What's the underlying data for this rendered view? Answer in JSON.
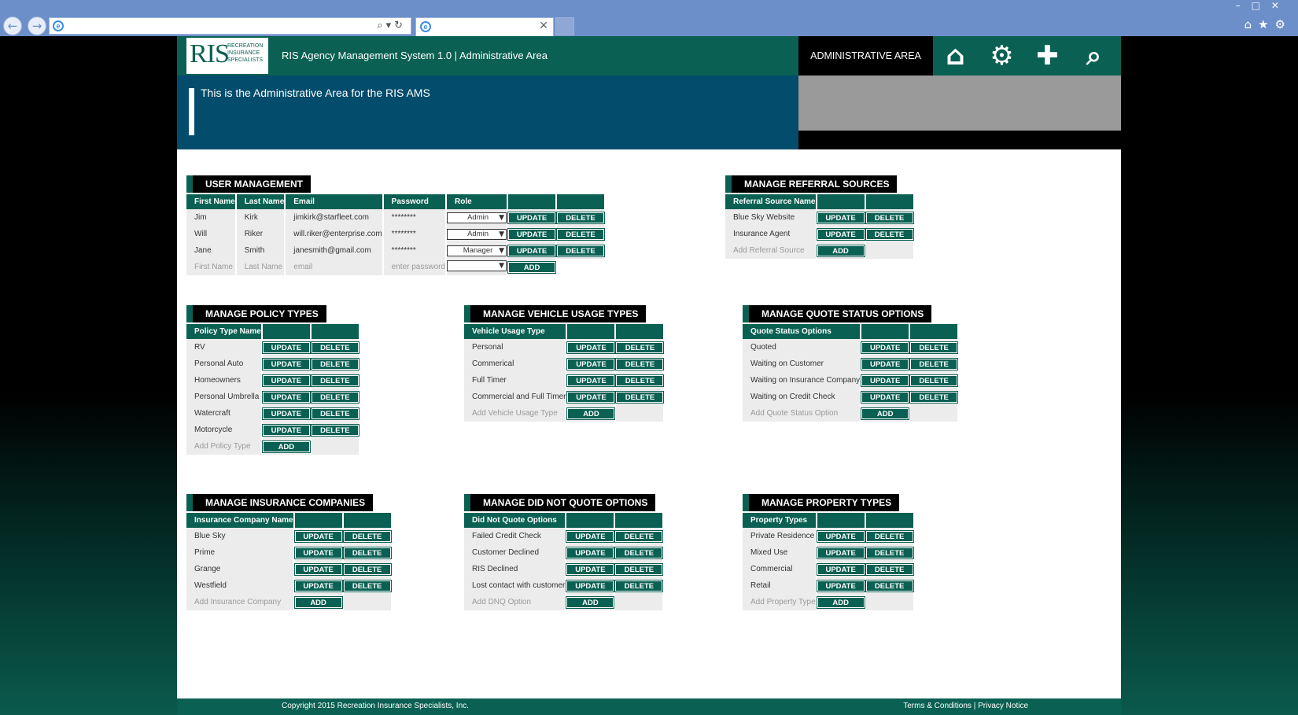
{
  "browser": {
    "back_icon": "back-arrow-icon",
    "forward_icon": "forward-arrow-icon",
    "address_value": "",
    "tab_title": ""
  },
  "header": {
    "logo_text": "RIS",
    "logo_sub": "RECREATION INSURANCE SPECIALISTS",
    "app_title": "RIS Agency Management System 1.0 | Administrative Area",
    "admin_label": "ADMINISTRATIVE AREA",
    "icons": [
      "home-icon",
      "gear-icon",
      "plus-icon",
      "search-icon"
    ]
  },
  "banner": {
    "text": "This is the Administrative Area for the RIS AMS"
  },
  "user_management": {
    "title": "USER MANAGEMENT",
    "columns": [
      "First Name",
      "Last Name",
      "Email",
      "Password",
      "Role",
      "",
      ""
    ],
    "rows": [
      {
        "first": "Jim",
        "last": "Kirk",
        "email": "jimkirk@starfleet.com",
        "password": "********",
        "role": "Admin"
      },
      {
        "first": "Will",
        "last": "Riker",
        "email": "will.riker@enterprise.com",
        "password": "********",
        "role": "Admin"
      },
      {
        "first": "Jane",
        "last": "Smith",
        "email": "janesmith@gmail.com",
        "password": "********",
        "role": "Manager"
      }
    ],
    "add_row": {
      "first": "First Name",
      "last": "Last Name",
      "email": "email",
      "password": "enter password",
      "role": ""
    },
    "update_label": "UPDATE",
    "delete_label": "DELETE",
    "add_label": "ADD"
  },
  "referral_sources": {
    "title": "MANAGE REFERRAL SOURCES",
    "column": "Referral Source Name",
    "items": [
      "Blue Sky Website",
      "Insurance Agent"
    ],
    "add_placeholder": "Add Referral Source"
  },
  "policy_types": {
    "title": "MANAGE POLICY TYPES",
    "column": "Policy Type Name",
    "items": [
      "RV",
      "Personal Auto",
      "Homeowners",
      "Personal Umbrella",
      "Watercraft",
      "Motorcycle"
    ],
    "add_placeholder": "Add Policy Type"
  },
  "vehicle_usage": {
    "title": "MANAGE VEHICLE USAGE TYPES",
    "column": "Vehicle Usage Type",
    "items": [
      "Personal",
      "Commerical",
      "Full Timer",
      "Commercial and Full Timer"
    ],
    "add_placeholder": "Add Vehicle Usage Type"
  },
  "quote_status": {
    "title": "MANAGE QUOTE STATUS OPTIONS",
    "column": "Quote Status Options",
    "items": [
      "Quoted",
      "Waiting on Customer",
      "Waiting on Insurance Company",
      "Waiting on Credit Check"
    ],
    "add_placeholder": "Add Quote Status Option"
  },
  "insurance_companies": {
    "title": "MANAGE INSURANCE COMPANIES",
    "column": "Insurance Company Name",
    "items": [
      "Blue Sky",
      "Prime",
      "Grange",
      "Westfield"
    ],
    "add_placeholder": "Add Insurance Company"
  },
  "did_not_quote": {
    "title": "MANAGE DID NOT QUOTE OPTIONS",
    "column": "Did Not Quote Options",
    "items": [
      "Failed Credit Check",
      "Customer Declined",
      "RIS Declined",
      "Lost contact with customer"
    ],
    "add_placeholder": "Add DNQ Option"
  },
  "property_types": {
    "title": "MANAGE PROPERTY TYPES",
    "column": "Property Types",
    "items": [
      "Private Residence",
      "Mixed Use",
      "Commercial",
      "Retail"
    ],
    "add_placeholder": "Add Property Type"
  },
  "buttons": {
    "update": "UPDATE",
    "delete": "DELETE",
    "add": "ADD"
  },
  "footer": {
    "copyright": "Copyright 2015 Recreation Insurance Specialists, Inc.",
    "terms": "Terms & Conditions",
    "separator": "|",
    "privacy": "Privacy Notice"
  },
  "colors": {
    "brand_green": "#0a6052",
    "banner_blue": "#034c6c",
    "chrome_blue": "#6c8fc9"
  }
}
